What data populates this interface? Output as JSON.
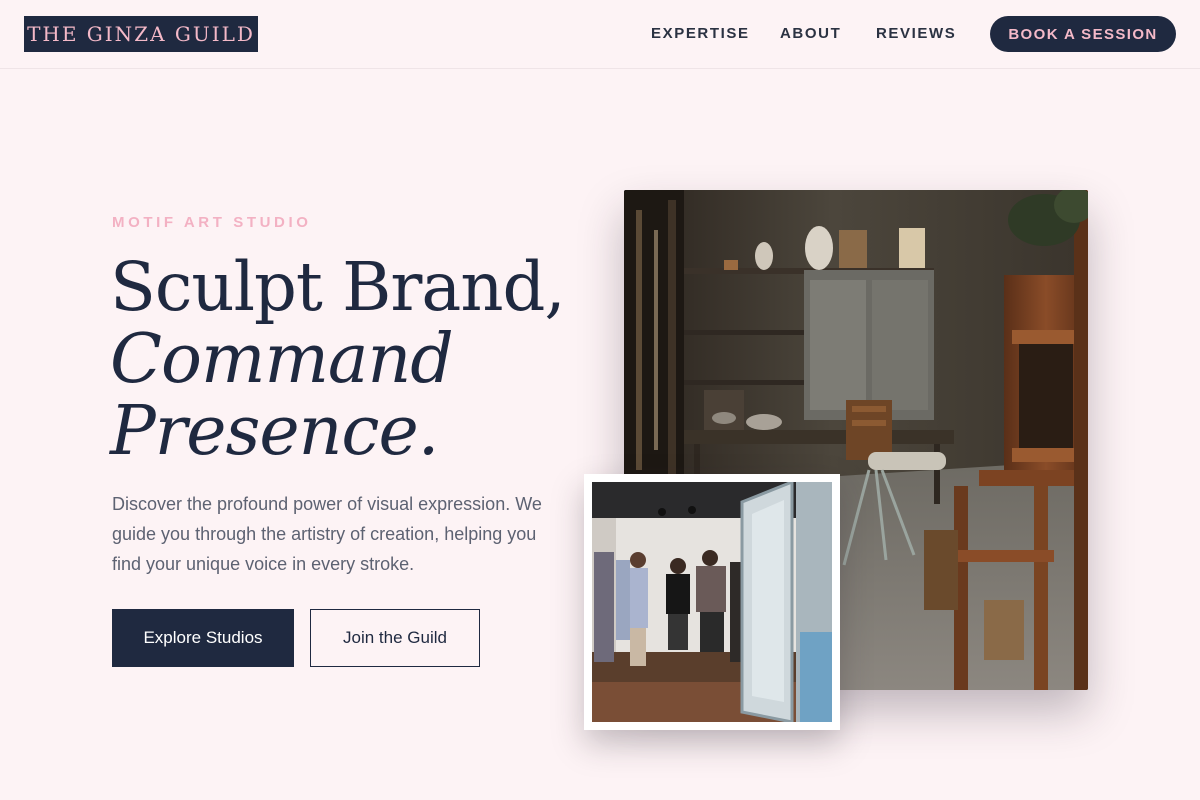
{
  "header": {
    "logo": "THE GINZA GUILD",
    "nav": [
      "EXPERTISE",
      "ABOUT",
      "REVIEWS"
    ],
    "cta": "BOOK A SESSION"
  },
  "hero": {
    "eyebrow": "MOTIF ART STUDIO",
    "headline": [
      "Sculpt Brand,",
      "Command",
      "Presence."
    ],
    "description": "Discover the profound power of visual expression. We guide you through the artistry of creation, helping you find your unique voice in every stroke.",
    "primary_button": "Explore Studios",
    "secondary_button": "Join the Guild"
  },
  "images": {
    "main_alt": "Artist studio with wooden easels and pottery shelves",
    "inset_alt": "People visiting an art gallery"
  },
  "colors": {
    "background": "#fdf3f5",
    "navy": "#1f2940",
    "pink_accent": "#f4b9c8",
    "body_text": "#5d6272"
  }
}
